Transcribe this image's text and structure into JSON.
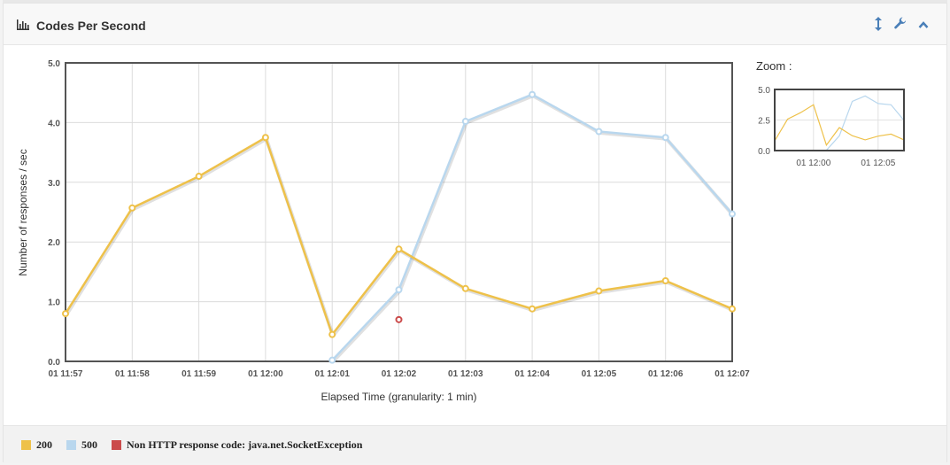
{
  "header": {
    "title": "Codes Per Second"
  },
  "zoom_label": "Zoom :",
  "colors": {
    "s200": "#eec14a",
    "s500": "#b9d7ee",
    "sExc": "#cb4b4b"
  },
  "chart_data": {
    "type": "line",
    "xlabel": "Elapsed Time (granularity: 1 min)",
    "ylabel": "Number of responses / sec",
    "ylim": [
      0,
      5
    ],
    "yticks": [
      "0.0",
      "1.0",
      "2.0",
      "3.0",
      "4.0",
      "5.0"
    ],
    "categories": [
      "01 11:57",
      "01 11:58",
      "01 11:59",
      "01 12:00",
      "01 12:01",
      "01 12:02",
      "01 12:03",
      "01 12:04",
      "01 12:05",
      "01 12:06",
      "01 12:07"
    ],
    "grid": true,
    "legend_position": "bottom",
    "series": [
      {
        "name": "200",
        "color": "#eec14a",
        "values": [
          0.8,
          2.57,
          3.1,
          3.75,
          0.45,
          1.88,
          1.22,
          0.88,
          1.18,
          1.35,
          0.88
        ]
      },
      {
        "name": "500",
        "color": "#b9d7ee",
        "values": [
          null,
          null,
          null,
          null,
          0.02,
          1.2,
          4.02,
          4.47,
          3.85,
          3.75,
          2.47
        ]
      },
      {
        "name": "Non HTTP response code: java.net.SocketException",
        "color": "#cb4b4b",
        "values": [
          null,
          null,
          null,
          null,
          null,
          0.7,
          null,
          null,
          null,
          null,
          null
        ]
      }
    ]
  },
  "zoom_chart": {
    "yticks": [
      "0.0",
      "2.5",
      "5.0"
    ],
    "xticks": [
      "01 12:00",
      "01 12:05"
    ],
    "xtick_index": [
      3,
      8
    ]
  }
}
